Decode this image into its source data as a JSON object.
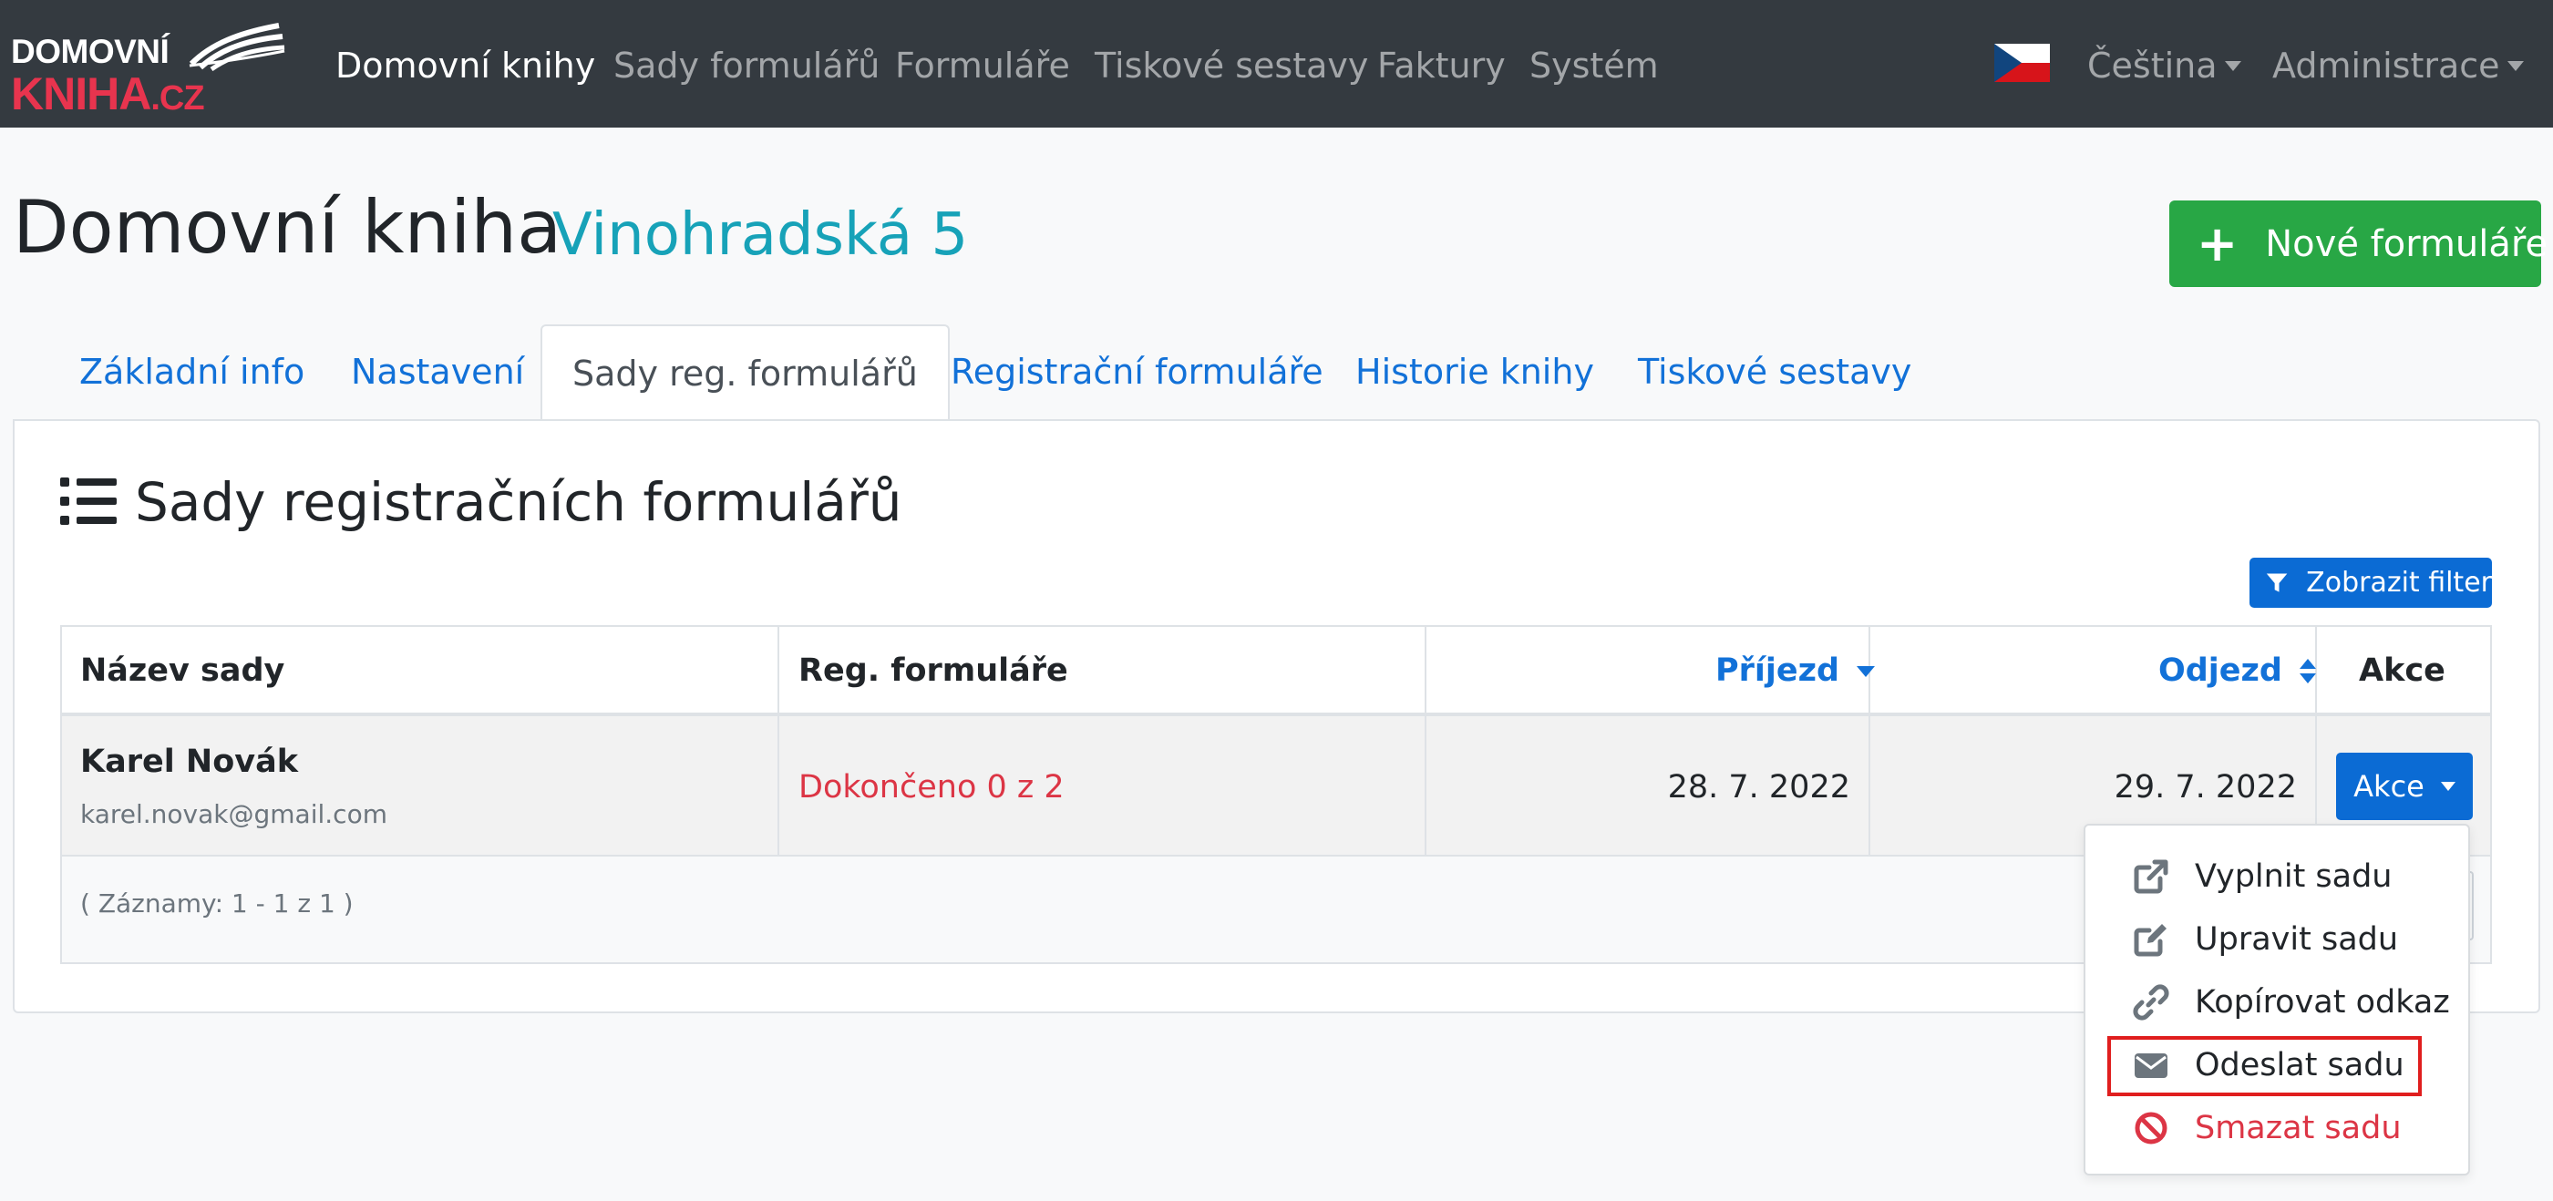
{
  "brand": {
    "line1": "DOMOVNÍ",
    "line2_main": "KNIHA",
    "line2_suffix": ".CZ"
  },
  "nav": {
    "items": [
      {
        "label": "Domovní knihy",
        "active": true
      },
      {
        "label": "Sady formulářů",
        "active": false
      },
      {
        "label": "Formuláře",
        "active": false
      },
      {
        "label": "Tiskové sestavy",
        "active": false
      },
      {
        "label": "Faktury",
        "active": false
      },
      {
        "label": "Systém",
        "active": false
      }
    ],
    "language": "Čeština",
    "user_menu": "Administrace"
  },
  "page": {
    "title": "Domovní kniha",
    "subtitle": "Vinohradská 5",
    "new_button": "Nové formuláře"
  },
  "tabs": [
    {
      "label": "Základní info",
      "active": false
    },
    {
      "label": "Nastavení",
      "active": false
    },
    {
      "label": "Sady reg. formulářů",
      "active": true
    },
    {
      "label": "Registrační formuláře",
      "active": false
    },
    {
      "label": "Historie knihy",
      "active": false
    },
    {
      "label": "Tiskové sestavy",
      "active": false
    }
  ],
  "card": {
    "title": "Sady registračních formulářů",
    "filter_button": "Zobrazit filter"
  },
  "table": {
    "columns": {
      "name": "Název sady",
      "forms": "Reg. formuláře",
      "arrival": "Příjezd",
      "departure": "Odjezd",
      "actions": "Akce"
    },
    "rows": [
      {
        "name": "Karel Novák",
        "email": "karel.novak@gmail.com",
        "forms_status": "Dokončeno 0 z 2",
        "arrival": "28. 7. 2022",
        "departure": "29. 7. 2022",
        "action_button": "Akce"
      }
    ],
    "records": "( Záznamy: 1 - 1 z 1 )"
  },
  "dropdown": {
    "items": [
      {
        "label": "Vyplnit sadu",
        "icon": "external-link-icon"
      },
      {
        "label": "Upravit sadu",
        "icon": "edit-icon"
      },
      {
        "label": "Kopírovat odkaz",
        "icon": "link-icon"
      },
      {
        "label": "Odeslat sadu",
        "icon": "envelope-icon",
        "highlighted": true
      },
      {
        "label": "Smazat sadu",
        "icon": "ban-icon",
        "danger": true
      }
    ]
  },
  "colors": {
    "navbar": "#343a40",
    "brand_red": "#e8344e",
    "link": "#1271d8",
    "accent_teal": "#17a2b8",
    "success": "#28a745",
    "primary": "#0b6bd4",
    "danger": "#dc3545",
    "highlight_box": "#e01e1e"
  }
}
